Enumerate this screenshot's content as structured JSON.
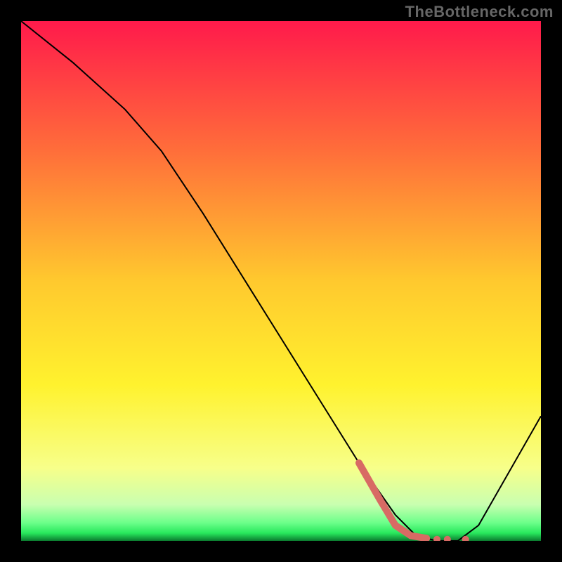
{
  "watermark": "TheBottleneck.com",
  "chart_data": {
    "type": "line",
    "title": "",
    "xlabel": "",
    "ylabel": "",
    "xlim": [
      0,
      100
    ],
    "ylim": [
      0,
      100
    ],
    "grid": false,
    "series": [
      {
        "name": "curve",
        "x": [
          0,
          10,
          20,
          27,
          35,
          45,
          55,
          65,
          72,
          76,
          80,
          84,
          88,
          92,
          100
        ],
        "y": [
          100,
          92,
          83,
          75,
          63,
          47,
          31,
          15,
          5,
          1,
          0,
          0,
          3,
          10,
          24
        ],
        "stroke": "#000000",
        "stroke_width": 2
      }
    ],
    "highlight_segment": {
      "x": [
        65,
        69,
        72,
        75,
        78
      ],
      "y": [
        15,
        8,
        3,
        1,
        0.5
      ],
      "stroke": "#d86a64",
      "stroke_width": 10
    },
    "highlight_dots": {
      "points": [
        {
          "x": 80,
          "y": 0.3
        },
        {
          "x": 82,
          "y": 0.3
        },
        {
          "x": 85.5,
          "y": 0.3
        }
      ],
      "fill": "#d86a64",
      "r": 5
    },
    "gradient_bg": {
      "stops": [
        {
          "offset": 0.0,
          "color": "#ff1a4b"
        },
        {
          "offset": 0.25,
          "color": "#ff6e3a"
        },
        {
          "offset": 0.5,
          "color": "#ffc92e"
        },
        {
          "offset": 0.7,
          "color": "#fff22e"
        },
        {
          "offset": 0.86,
          "color": "#f7ff8a"
        },
        {
          "offset": 0.93,
          "color": "#c9ffb0"
        },
        {
          "offset": 0.965,
          "color": "#6cff8a"
        },
        {
          "offset": 0.985,
          "color": "#28e85c"
        },
        {
          "offset": 1.0,
          "color": "#0a7a2f"
        }
      ]
    }
  }
}
